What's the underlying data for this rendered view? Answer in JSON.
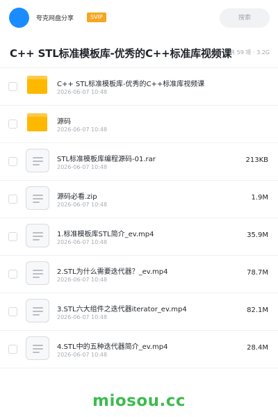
{
  "topbar": {
    "account_name": "夸克网盘分享",
    "badge": "SVIP",
    "search_placeholder": "搜索"
  },
  "header": {
    "title": "C++ STL标准模板库-优秀的C++标准库视频课",
    "meta": "共 59 项 · 3.2G"
  },
  "files": [
    {
      "type": "folder",
      "name": "C++ STL标准模板库-优秀的C++标准库视频课",
      "date": "2026-06-07 10:48",
      "size": ""
    },
    {
      "type": "folder",
      "name": "源码",
      "date": "2026-06-07 10:48",
      "size": ""
    },
    {
      "type": "file",
      "name": "STL标准模板库编程源码-01.rar",
      "date": "2026-06-07 10:48",
      "size": "213KB"
    },
    {
      "type": "file",
      "name": "源码必看.zip",
      "date": "2026-06-07 10:48",
      "size": "1.9M"
    },
    {
      "type": "file",
      "name": "1.标准模板库STL简介_ev.mp4",
      "date": "2026-06-07 10:48",
      "size": "35.9M"
    },
    {
      "type": "file",
      "name": "2.STL为什么需要迭代器？_ev.mp4",
      "date": "2026-06-07 10:48",
      "size": "78.7M"
    },
    {
      "type": "file",
      "name": "3.STL六大组件之迭代器iterator_ev.mp4",
      "date": "2026-06-07 10:48",
      "size": "82.1M"
    },
    {
      "type": "file",
      "name": "4.STL中的五种迭代器简介_ev.mp4",
      "date": "2026-06-07 10:48",
      "size": "28.4M"
    }
  ],
  "watermark": "miosou.cc",
  "colors": {
    "accent": "#1a8cff",
    "badge": "#f6a623",
    "folder": "#ffb800",
    "watermark": "#3dbb4f"
  },
  "icons": {
    "folder": "folder-icon",
    "file": "document-icon",
    "avatar": "avatar"
  }
}
